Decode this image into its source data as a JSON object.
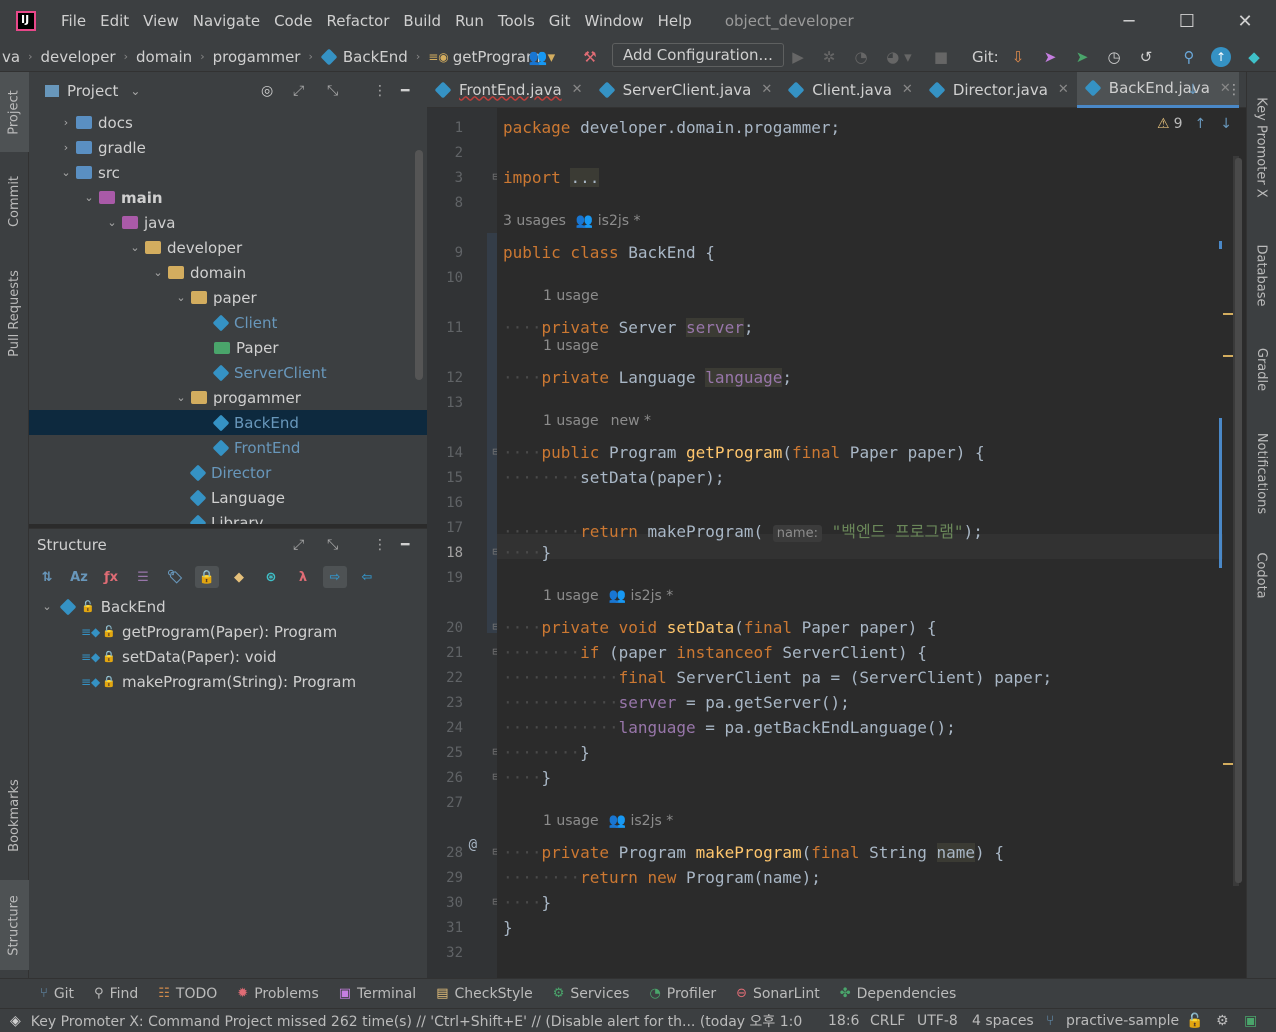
{
  "menu": [
    "File",
    "Edit",
    "View",
    "Navigate",
    "Code",
    "Refactor",
    "Build",
    "Run",
    "Tools",
    "Git",
    "Window",
    "Help"
  ],
  "window_title": "object_developer",
  "breadcrumb": [
    "va",
    "developer",
    "domain",
    "progammer",
    "BackEnd",
    "getProgram"
  ],
  "run_config": "Add Configuration...",
  "git_label": "Git:",
  "project_panel": {
    "title": "Project"
  },
  "tree": [
    {
      "label": "docs",
      "depth": 1,
      "arrow": "›",
      "icon": "folderb"
    },
    {
      "label": "gradle",
      "depth": 1,
      "arrow": "›",
      "icon": "folderb"
    },
    {
      "label": "src",
      "depth": 1,
      "arrow": "⌄",
      "icon": "folderb"
    },
    {
      "label": "main",
      "depth": 2,
      "arrow": "⌄",
      "icon": "folderp",
      "bold": true
    },
    {
      "label": "java",
      "depth": 3,
      "arrow": "⌄",
      "icon": "folderp"
    },
    {
      "label": "developer",
      "depth": 4,
      "arrow": "⌄",
      "icon": "folder"
    },
    {
      "label": "domain",
      "depth": 5,
      "arrow": "⌄",
      "icon": "folder"
    },
    {
      "label": "paper",
      "depth": 6,
      "arrow": "⌄",
      "icon": "folder"
    },
    {
      "label": "Client",
      "depth": 7,
      "arrow": "",
      "icon": "cls",
      "color": "#6897bb"
    },
    {
      "label": "Paper",
      "depth": 7,
      "arrow": "",
      "icon": "iface"
    },
    {
      "label": "ServerClient",
      "depth": 7,
      "arrow": "",
      "icon": "cls",
      "color": "#6897bb"
    },
    {
      "label": "progammer",
      "depth": 6,
      "arrow": "⌄",
      "icon": "folder"
    },
    {
      "label": "BackEnd",
      "depth": 7,
      "arrow": "",
      "icon": "cls",
      "color": "#6897bb",
      "selected": true
    },
    {
      "label": "FrontEnd",
      "depth": 7,
      "arrow": "",
      "icon": "cls",
      "color": "#6897bb"
    },
    {
      "label": "Director",
      "depth": 6,
      "arrow": "",
      "icon": "cls",
      "color": "#6897bb"
    },
    {
      "label": "Language",
      "depth": 6,
      "arrow": "",
      "icon": "cls"
    },
    {
      "label": "Library",
      "depth": 6,
      "arrow": "",
      "icon": "cls"
    }
  ],
  "structure_panel": {
    "title": "Structure",
    "root": "BackEnd",
    "members": [
      "getProgram(Paper): Program",
      "setData(Paper): void",
      "makeProgram(String): Program"
    ]
  },
  "tabs": [
    {
      "label": "FrontEnd.java",
      "active": false
    },
    {
      "label": "ServerClient.java",
      "active": false
    },
    {
      "label": "Client.java",
      "active": false
    },
    {
      "label": "Director.java",
      "active": false
    },
    {
      "label": "BackEnd.java",
      "active": true
    }
  ],
  "editor": {
    "warnings": "9",
    "line_numbers": [
      "1",
      "2",
      "3",
      "8",
      "9",
      "10",
      "11",
      "12",
      "13",
      "14",
      "15",
      "16",
      "17",
      "18",
      "19",
      "20",
      "21",
      "22",
      "23",
      "24",
      "25",
      "26",
      "27",
      "28",
      "29",
      "30",
      "31",
      "32"
    ],
    "hint_3usages": "3 usages",
    "hint_author": "is2js *",
    "hint_1usage": "1 usage",
    "hint_new": "new *",
    "param_hint": "name:",
    "string_literal": "\"백엔드 프로그램\""
  },
  "left_tools": [
    "Project",
    "Commit",
    "Pull Requests",
    "Bookmarks",
    "Structure"
  ],
  "right_tools": [
    "Key Promoter X",
    "Database",
    "Gradle",
    "Notifications",
    "Codota"
  ],
  "bottom_tabs": [
    "Git",
    "Find",
    "TODO",
    "Problems",
    "Terminal",
    "CheckStyle",
    "Services",
    "Profiler",
    "SonarLint",
    "Dependencies"
  ],
  "status": {
    "message": "Key Promoter X: Command Project missed 262 time(s) // 'Ctrl+Shift+E' // (Disable alert for th... (today 오후 1:0",
    "position": "18:6",
    "line_ending": "CRLF",
    "encoding": "UTF-8",
    "indent": "4 spaces",
    "branch": "practive-sample"
  }
}
